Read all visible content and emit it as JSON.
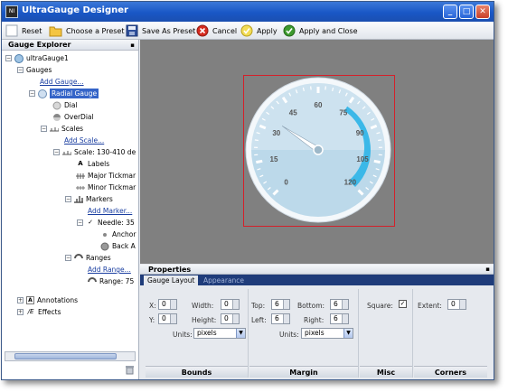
{
  "window": {
    "title": "UltraGauge Designer",
    "icon_label": "NI",
    "minimize": "_",
    "maximize": "□",
    "close": "✕"
  },
  "toolbar": {
    "reset": "Reset",
    "choose_preset": "Choose a Preset",
    "save_preset": "Save As Preset",
    "cancel": "Cancel",
    "apply": "Apply",
    "apply_close": "Apply and Close"
  },
  "explorer": {
    "title": "Gauge Explorer",
    "pin": "▪",
    "tree": {
      "root": "ultraGauge1",
      "gauges": "Gauges",
      "add_gauge": "Add Gauge...",
      "radial_gauge": "Radial Gauge",
      "dial": "Dial",
      "overdial": "OverDial",
      "scales": "Scales",
      "add_scale": "Add Scale...",
      "scale": "Scale: 130-410 de",
      "labels": "Labels",
      "major_tickmarks": "Major Tickmar",
      "minor_tickmarks": "Minor Tickmar",
      "markers": "Markers",
      "add_marker": "Add Marker...",
      "needle": "Needle: 35",
      "anchor": "Anchor",
      "back": "Back A",
      "ranges": "Ranges",
      "add_range": "Add Range...",
      "range": "Range: 75",
      "annotations": "Annotations",
      "effects": "Effects"
    }
  },
  "gauge": {
    "scale_labels": [
      "0",
      "15",
      "30",
      "45",
      "60",
      "75",
      "90",
      "105",
      "120"
    ],
    "needle_value": 35,
    "range_start": 75,
    "range_end": 120,
    "colors": {
      "face": "#bcd9ea",
      "range": "#3bb8e8",
      "frame": "#d4202a"
    }
  },
  "properties": {
    "title": "Properties",
    "pin": "▪",
    "tabs": {
      "gauge_layout": "Gauge Layout",
      "appearance": "Appearance"
    },
    "bounds": {
      "x_label": "X:",
      "x": "0",
      "y_label": "Y:",
      "y": "0",
      "width_label": "Width:",
      "width": "0",
      "height_label": "Height:",
      "height": "0",
      "units_label": "Units:",
      "units": "pixels",
      "footer": "Bounds"
    },
    "margin": {
      "top_label": "Top:",
      "top": "6",
      "left_label": "Left:",
      "left": "6",
      "bottom_label": "Bottom:",
      "bottom": "6",
      "right_label": "Right:",
      "right": "6",
      "units_label": "Units:",
      "units": "pixels",
      "footer": "Margin"
    },
    "misc": {
      "square_label": "Square:",
      "square_checked": "✓",
      "footer": "Misc"
    },
    "corners": {
      "extent_label": "Extent:",
      "extent": "0",
      "footer": "Corners"
    },
    "dropdown_arrow": "▼"
  }
}
